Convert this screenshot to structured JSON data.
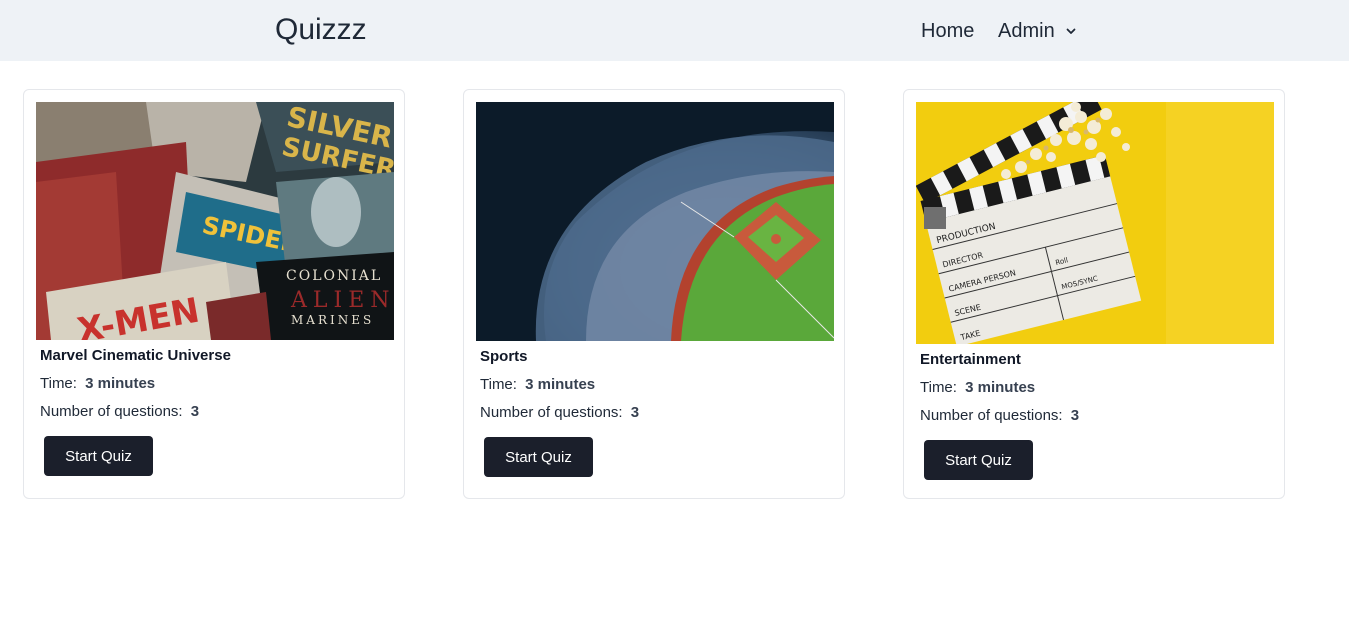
{
  "nav": {
    "brand": "Quizzz",
    "home": "Home",
    "admin": "Admin"
  },
  "quizzes": [
    {
      "title": "Marvel Cinematic Universe",
      "time_label": "Time:",
      "time_value": "3 minutes",
      "questions_label": "Number of questions:",
      "questions_value": "3",
      "button": "Start Quiz",
      "image": "comic-books-collage"
    },
    {
      "title": "Sports",
      "time_label": "Time:",
      "time_value": "3 minutes",
      "questions_label": "Number of questions:",
      "questions_value": "3",
      "button": "Start Quiz",
      "image": "baseball-stadium"
    },
    {
      "title": "Entertainment",
      "time_label": "Time:",
      "time_value": "3 minutes",
      "questions_label": "Number of questions:",
      "questions_value": "3",
      "button": "Start Quiz",
      "image": "clapperboard-popcorn"
    }
  ],
  "colors": {
    "navbar_bg": "#eef2f6",
    "button_bg": "#1b1f2b",
    "button_text": "#ffffff"
  }
}
